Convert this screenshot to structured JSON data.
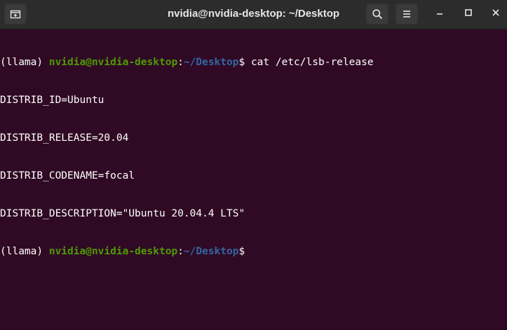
{
  "window": {
    "title": "nvidia@nvidia-desktop: ~/Desktop"
  },
  "titlebar": {
    "buttons": [
      {
        "icon": "new-tab-icon"
      },
      {
        "icon": "search-icon"
      },
      {
        "icon": "hamburger-menu-icon"
      },
      {
        "icon": "minimize-icon"
      },
      {
        "icon": "maximize-icon"
      },
      {
        "icon": "close-icon"
      }
    ]
  },
  "terminal": {
    "colors": {
      "background": "#300a24",
      "user_host": "#4e9a06",
      "path": "#3465a4",
      "text": "#ffffff"
    },
    "prompt1": {
      "env": "(llama) ",
      "user_host": "nvidia@nvidia-desktop",
      "colon": ":",
      "path": "~/Desktop",
      "symbol": "$ ",
      "command": "cat /etc/lsb-release"
    },
    "output": [
      "DISTRIB_ID=Ubuntu",
      "DISTRIB_RELEASE=20.04",
      "DISTRIB_CODENAME=focal",
      "DISTRIB_DESCRIPTION=\"Ubuntu 20.04.4 LTS\""
    ],
    "prompt2": {
      "env": "(llama) ",
      "user_host": "nvidia@nvidia-desktop",
      "colon": ":",
      "path": "~/Desktop",
      "symbol": "$"
    }
  }
}
